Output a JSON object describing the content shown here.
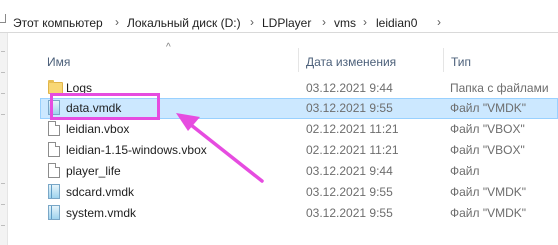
{
  "breadcrumb": [
    "Этот компьютер",
    "Локальный диск (D:)",
    "LDPlayer",
    "vms",
    "leidian0"
  ],
  "columns": {
    "name": "Имя",
    "date": "Дата изменения",
    "type": "Тип"
  },
  "rows": [
    {
      "name": "Logs",
      "date": "03.12.2021 9:44",
      "type": "Папка с файлами",
      "icon": "folder-icon"
    },
    {
      "name": "data.vmdk",
      "date": "03.12.2021 9:55",
      "type": "Файл \"VMDK\"",
      "icon": "disk-file-icon"
    },
    {
      "name": "leidian.vbox",
      "date": "02.12.2021 11:21",
      "type": "Файл \"VBOX\"",
      "icon": "file-icon"
    },
    {
      "name": "leidian-1.15-windows.vbox",
      "date": "02.12.2021 11:21",
      "type": "Файл \"VBOX\"",
      "icon": "file-icon"
    },
    {
      "name": "player_life",
      "date": "03.12.2021 9:44",
      "type": "Файл",
      "icon": "file-icon"
    },
    {
      "name": "sdcard.vmdk",
      "date": "03.12.2021 9:55",
      "type": "Файл \"VMDK\"",
      "icon": "disk-file-icon"
    },
    {
      "name": "system.vmdk",
      "date": "03.12.2021 9:55",
      "type": "Файл \"VMDK\"",
      "icon": "disk-file-icon"
    }
  ],
  "colors": {
    "selection": "#cce8ff",
    "annotation": "#e64ce0"
  }
}
